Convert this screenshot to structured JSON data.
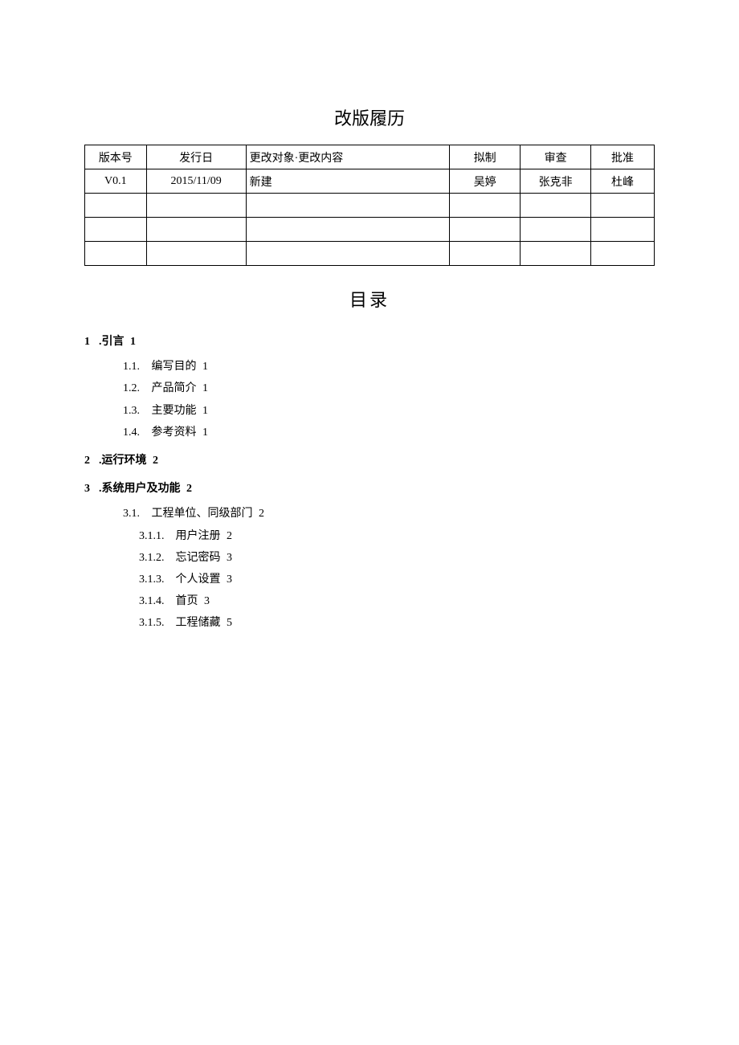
{
  "revision": {
    "title": "改版履历",
    "headers": {
      "version": "版本号",
      "date": "发行日",
      "change": "更改对象·更改内容",
      "author": "拟制",
      "review": "审查",
      "approve": "批准"
    },
    "rows": [
      {
        "version": "V0.1",
        "date": "2015/11/09",
        "change": "新建",
        "author": "吴婷",
        "review": "张克非",
        "approve": "杜峰"
      },
      {
        "version": "",
        "date": "",
        "change": "",
        "author": "",
        "review": "",
        "approve": ""
      },
      {
        "version": "",
        "date": "",
        "change": "",
        "author": "",
        "review": "",
        "approve": ""
      },
      {
        "version": "",
        "date": "",
        "change": "",
        "author": "",
        "review": "",
        "approve": ""
      }
    ]
  },
  "toc": {
    "title": "目录",
    "items": [
      {
        "level": 1,
        "num": "1",
        "dot": ".",
        "text": "引言",
        "page": "1"
      },
      {
        "level": 2,
        "num": "1.1.",
        "text": "编写目的",
        "page": "1"
      },
      {
        "level": 2,
        "num": "1.2.",
        "text": "产品简介",
        "page": "1"
      },
      {
        "level": 2,
        "num": "1.3.",
        "text": "主要功能",
        "page": "1"
      },
      {
        "level": 2,
        "num": "1.4.",
        "text": "参考资料",
        "page": "1"
      },
      {
        "level": 1,
        "num": "2",
        "dot": ".",
        "text": "运行环境",
        "page": "2"
      },
      {
        "level": 1,
        "num": "3",
        "dot": ".",
        "text": "系统用户及功能",
        "page": "2"
      },
      {
        "level": 2,
        "num": "3.1.",
        "text": "工程单位、同级部门",
        "page": "2"
      },
      {
        "level": 3,
        "num": "3.1.1.",
        "text": "用户注册",
        "page": "2"
      },
      {
        "level": 3,
        "num": "3.1.2.",
        "text": "忘记密码",
        "page": "3"
      },
      {
        "level": 3,
        "num": "3.1.3.",
        "text": "个人设置",
        "page": "3"
      },
      {
        "level": 3,
        "num": "3.1.4.",
        "text": "首页",
        "page": "3"
      },
      {
        "level": 3,
        "num": "3.1.5.",
        "text": "工程储藏",
        "page": "5"
      }
    ]
  }
}
